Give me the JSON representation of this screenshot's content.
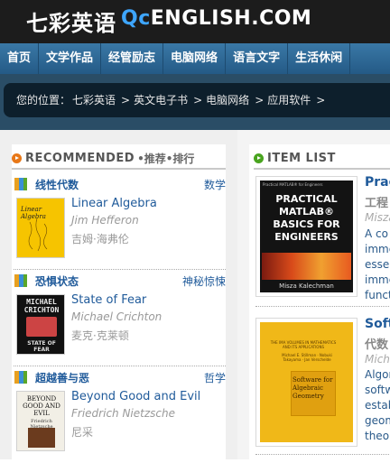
{
  "header": {
    "logo_cn": "七彩英语",
    "logo_q": "Qc",
    "logo_en": "ENGLISH.COM"
  },
  "nav": {
    "items": [
      "首页",
      "文学作品",
      "经管励志",
      "电脑网络",
      "语言文字",
      "生活休闲"
    ]
  },
  "breadcrumb": {
    "prefix": "您的位置：",
    "items": [
      "七彩英语",
      "英文电子书",
      "电脑网络",
      "应用软件"
    ],
    "separator": ">"
  },
  "recommended": {
    "title_en": "RECOMMENDED",
    "title_cn": "•推荐•排行",
    "entries": [
      {
        "category": "线性代数",
        "genre": "数学",
        "title": "Linear Algebra",
        "author": "Jim Hefferon",
        "author_cn": "吉姆·海弗伦",
        "cover_text": "Linear Algebra"
      },
      {
        "category": "恐惧状态",
        "genre": "神秘惊悚",
        "title": "State of Fear",
        "author": "Michael Crichton",
        "author_cn": "麦克·克莱顿",
        "cover_top": "MICHAEL CRICHTON",
        "cover_bottom": "STATE OF FEAR"
      },
      {
        "category": "超越善与恶",
        "genre": "哲学",
        "title": "Beyond Good and Evil",
        "author": "Friedrich Nietzsche",
        "author_cn": "尼采",
        "cover_top": "BEYOND GOOD AND EVIL",
        "cover_author": "Friedrich Nietzsche"
      }
    ]
  },
  "item_list": {
    "title": "ITEM LIST",
    "items": [
      {
        "title": "Prac",
        "title_cn": "工程",
        "author": "Misza",
        "description": [
          "A co",
          "imme",
          "esse",
          "imme",
          "funct"
        ],
        "cover_top_line": "Practical MATLAB® for Engineers",
        "cover_title": "PRACTICAL MATLAB® BASICS FOR ENGINEERS",
        "cover_author": "Misza Kalechman"
      },
      {
        "title": "Soft",
        "title_cn": "代数",
        "author": "Micha",
        "description": [
          "Algor",
          "softw",
          "estab",
          "geom",
          "theor"
        ],
        "cover_series": "THE IMA VOLUMES IN MATHEMATICS AND ITS APPLICATIONS",
        "cover_authors": "Michael E. Stillman · Nobuki Takayama · Jan Verschelde",
        "cover_title": "Software for Algebraic Geometry"
      }
    ]
  },
  "colors": {
    "header_bg": "#1c1c1c",
    "nav_bg": "#2d6a99",
    "link": "#1f5a9a",
    "accent_orange": "#e87818",
    "accent_green": "#49a41f"
  }
}
